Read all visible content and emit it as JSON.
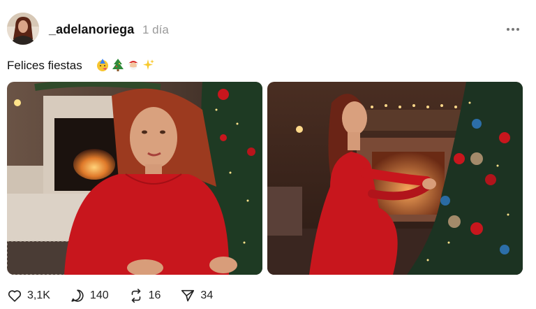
{
  "post": {
    "username": "_adelanoriega",
    "time": "1 día",
    "caption": "Felices fiestas",
    "emojis": [
      "face-with-party-hat-emoji",
      "christmas-tree-emoji",
      "santa-claus-emoji",
      "sparkles-emoji"
    ]
  },
  "actions": {
    "likes": "3,1K",
    "replies": "140",
    "reposts": "16",
    "shares": "34"
  },
  "colors": {
    "accent_red": "#c8161d",
    "tree_green": "#1e3a23",
    "text": "#111111",
    "muted": "#9a9a9a"
  }
}
